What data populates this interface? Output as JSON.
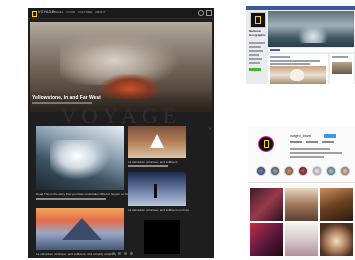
{
  "site": {
    "logo": "VOYAGE",
    "nav": [
      "TRAVEL",
      "FOOD",
      "CULTURE",
      "ABOUT"
    ],
    "hero_title": "Yellowstone, In and Far West",
    "watermark": "VOYAGE",
    "story_a": "Read This is the story that you have undertaken Brief of hopper on forfeit",
    "story_b": "La sabuidum volunteer, and sufficient",
    "story_c": "La sabuidum volunteer, and sufficient on fruits",
    "story_d": "La sabuidum volunteer, and sufficient, visit simplify voluntary"
  },
  "facebook": {
    "page_name": "National Geographic"
  },
  "instagram": {
    "username": "natgeo_travel"
  },
  "colors": {
    "dark_bg": "#1e1e1e",
    "brand_yellow": "#ffd200",
    "fb_blue": "#3b5998",
    "ig_blue": "#3897f0"
  }
}
